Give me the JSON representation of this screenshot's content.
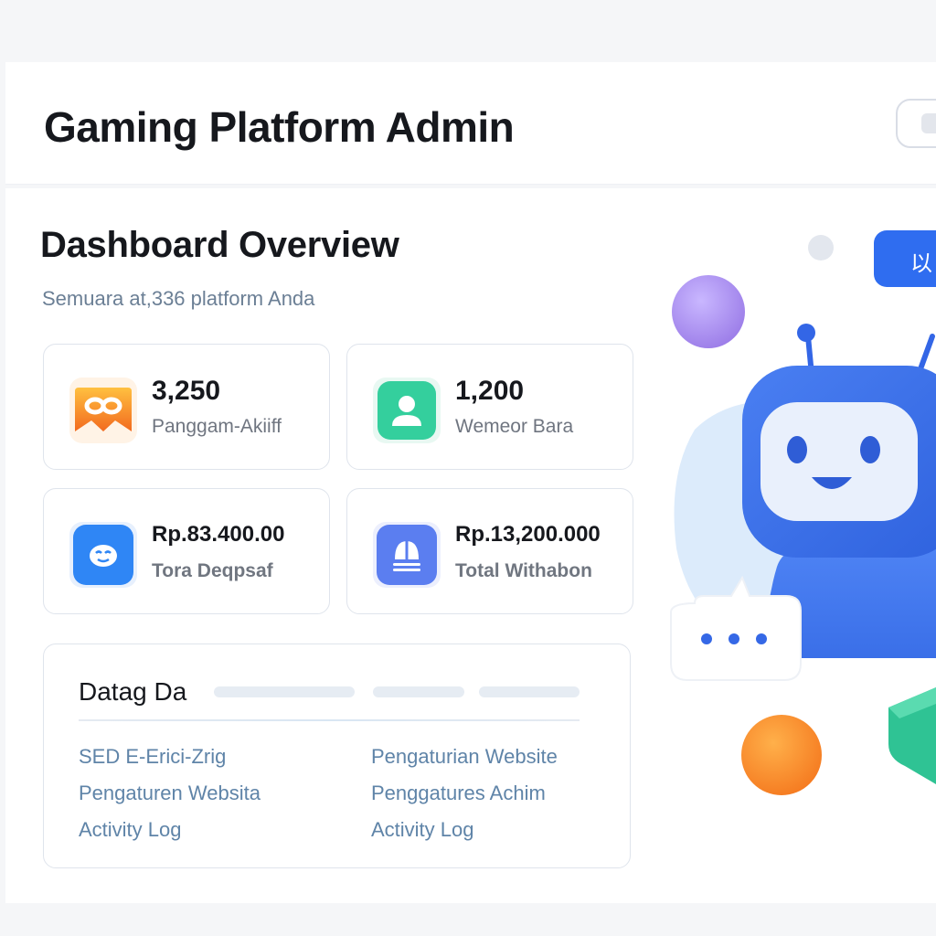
{
  "header": {
    "title": "Gaming Platform Admin"
  },
  "dashboard": {
    "title": "Dashboard Overview",
    "subtitle": "Semuara at,336 platform Anda"
  },
  "top_right_button": {
    "label": "以"
  },
  "stats": [
    {
      "value": "3,250",
      "label": "Panggam-Akiiff",
      "icon": "gamepad-icon",
      "color": "#f5872a"
    },
    {
      "value": "1,200",
      "label": "Wemeor Bara",
      "icon": "user-icon",
      "color": "#2fcf9e"
    },
    {
      "value": "Rp.83.400.00",
      "label": "Tora Deqpsaf",
      "icon": "smile-face-icon",
      "color": "#2f86f5"
    },
    {
      "value": "Rp.13,200.000",
      "label": "Total Withabon",
      "icon": "boat-icon",
      "color": "#5b7ef0"
    }
  ],
  "data_panel": {
    "title": "Datag Da",
    "links_left": [
      "SED E-Erici-Zrig",
      "Pengaturen Websita",
      "Activity Log"
    ],
    "links_right": [
      "Pengaturian Website",
      "Penggatures Achim",
      "Activity Log"
    ]
  },
  "colors": {
    "accent": "#2f6df0",
    "robot": "#3568e6",
    "orange_ball": "#f5872a",
    "purple_ball": "#a98cf2",
    "green_block": "#2fc394"
  }
}
